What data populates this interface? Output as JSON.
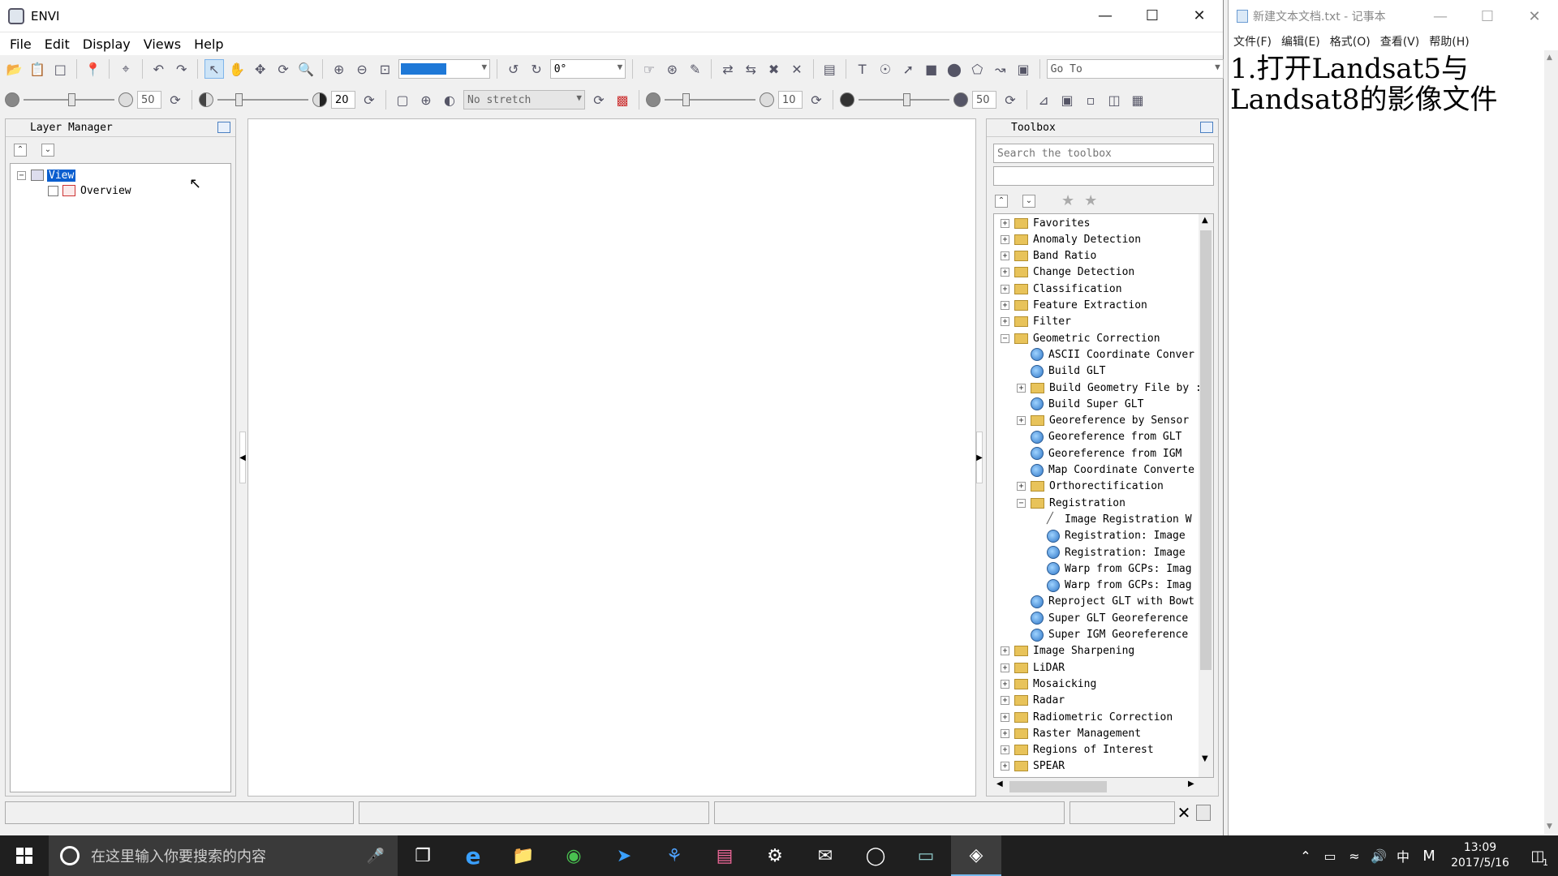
{
  "envi": {
    "title": "ENVI",
    "menu": [
      "File",
      "Edit",
      "Display",
      "Views",
      "Help"
    ],
    "rotation_value": "0°",
    "goto_placeholder": "Go To",
    "brightness_value": "50",
    "contrast_value": "20",
    "stretch_value": "No stretch",
    "sharpen_value": "10",
    "transparency_value": "50"
  },
  "layer_manager": {
    "title": "Layer Manager",
    "root": "View",
    "child": "Overview"
  },
  "toolbox": {
    "title": "Toolbox",
    "search_placeholder": "Search the toolbox",
    "items": [
      {
        "label": "Favorites",
        "kind": "folder",
        "exp": "+",
        "level": 0
      },
      {
        "label": "Anomaly Detection",
        "kind": "folder",
        "exp": "+",
        "level": 0
      },
      {
        "label": "Band Ratio",
        "kind": "folder",
        "exp": "+",
        "level": 0
      },
      {
        "label": "Change Detection",
        "kind": "folder",
        "exp": "+",
        "level": 0
      },
      {
        "label": "Classification",
        "kind": "folder",
        "exp": "+",
        "level": 0
      },
      {
        "label": "Feature Extraction",
        "kind": "folder",
        "exp": "+",
        "level": 0
      },
      {
        "label": "Filter",
        "kind": "folder",
        "exp": "+",
        "level": 0
      },
      {
        "label": "Geometric Correction",
        "kind": "folder",
        "exp": "−",
        "level": 0
      },
      {
        "label": "ASCII Coordinate Conver",
        "kind": "tool",
        "level": 1
      },
      {
        "label": "Build GLT",
        "kind": "tool",
        "level": 1
      },
      {
        "label": "Build Geometry File by :",
        "kind": "folder",
        "exp": "+",
        "level": 1
      },
      {
        "label": "Build Super GLT",
        "kind": "tool",
        "level": 1
      },
      {
        "label": "Georeference by Sensor",
        "kind": "folder",
        "exp": "+",
        "level": 1
      },
      {
        "label": "Georeference from GLT",
        "kind": "tool",
        "level": 1
      },
      {
        "label": "Georeference from IGM",
        "kind": "tool",
        "level": 1
      },
      {
        "label": "Map Coordinate Converte",
        "kind": "tool",
        "level": 1
      },
      {
        "label": "Orthorectification",
        "kind": "folder",
        "exp": "+",
        "level": 1
      },
      {
        "label": "Registration",
        "kind": "folder",
        "exp": "−",
        "level": 1
      },
      {
        "label": "Image Registration W",
        "kind": "wand",
        "level": 2
      },
      {
        "label": "Registration: Image",
        "kind": "tool",
        "level": 2
      },
      {
        "label": "Registration: Image",
        "kind": "tool",
        "level": 2
      },
      {
        "label": "Warp from GCPs: Imag",
        "kind": "tool",
        "level": 2
      },
      {
        "label": "Warp from GCPs: Imag",
        "kind": "tool",
        "level": 2
      },
      {
        "label": "Reproject GLT with Bowt",
        "kind": "tool",
        "level": 1
      },
      {
        "label": "Super GLT Georeference",
        "kind": "tool",
        "level": 1
      },
      {
        "label": "Super IGM Georeference",
        "kind": "tool",
        "level": 1
      },
      {
        "label": "Image Sharpening",
        "kind": "folder",
        "exp": "+",
        "level": 0
      },
      {
        "label": "LiDAR",
        "kind": "folder",
        "exp": "+",
        "level": 0
      },
      {
        "label": "Mosaicking",
        "kind": "folder",
        "exp": "+",
        "level": 0
      },
      {
        "label": "Radar",
        "kind": "folder",
        "exp": "+",
        "level": 0
      },
      {
        "label": "Radiometric Correction",
        "kind": "folder",
        "exp": "+",
        "level": 0
      },
      {
        "label": "Raster Management",
        "kind": "folder",
        "exp": "+",
        "level": 0
      },
      {
        "label": "Regions of Interest",
        "kind": "folder",
        "exp": "+",
        "level": 0
      },
      {
        "label": "SPEAR",
        "kind": "folder",
        "exp": "+",
        "level": 0
      }
    ]
  },
  "notepad": {
    "title": "新建文本文档.txt - 记事本",
    "menu": [
      "文件(F)",
      "编辑(E)",
      "格式(O)",
      "查看(V)",
      "帮助(H)"
    ],
    "content_line1": "1.打开Landsat5与",
    "content_line2": "Landsat8的影像文件"
  },
  "taskbar": {
    "search_placeholder": "在这里输入你要搜索的内容",
    "time": "13:09",
    "date": "2017/5/16",
    "ime": "中",
    "ime2": "M",
    "notification_count": "1"
  }
}
